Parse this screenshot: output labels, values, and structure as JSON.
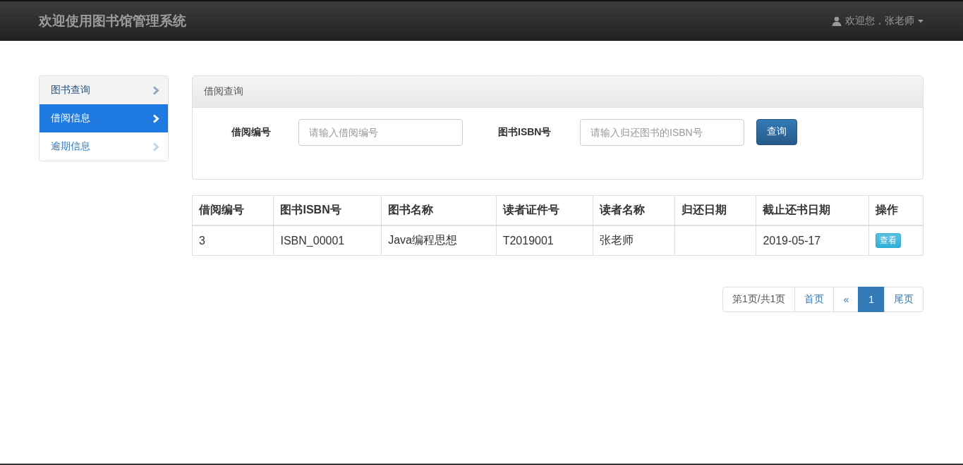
{
  "navbar": {
    "brand": "欢迎使用图书馆管理系统",
    "user_menu": "欢迎您，张老师"
  },
  "sidebar": {
    "items": [
      {
        "label": "图书查询",
        "selected": false,
        "hovered": true
      },
      {
        "label": "借阅信息",
        "selected": true,
        "hovered": false
      },
      {
        "label": "逾期信息",
        "selected": false,
        "hovered": false
      }
    ]
  },
  "search_panel": {
    "title": "借阅查询",
    "fields": [
      {
        "label": "借阅编号",
        "placeholder": "请输入借阅编号"
      },
      {
        "label": "图书ISBN号",
        "placeholder": "请输入归还图书的ISBN号"
      }
    ],
    "button": "查询"
  },
  "table": {
    "columns": [
      "借阅编号",
      "图书ISBN号",
      "图书名称",
      "读者证件号",
      "读者名称",
      "归还日期",
      "截止还书日期",
      "操作"
    ],
    "rows": [
      {
        "cells": [
          "3",
          "ISBN_00001",
          "Java编程思想",
          "T2019001",
          "张老师",
          "",
          "2019-05-17"
        ],
        "action": "查看"
      }
    ]
  },
  "pagination": [
    {
      "label": "第1页/共1页",
      "kind": "info"
    },
    {
      "label": "首页",
      "kind": "link",
      "selected": false
    },
    {
      "label": "«",
      "kind": "link",
      "selected": false
    },
    {
      "label": "1",
      "kind": "link",
      "selected": true
    },
    {
      "label": "尾页",
      "kind": "link",
      "selected": false
    }
  ]
}
